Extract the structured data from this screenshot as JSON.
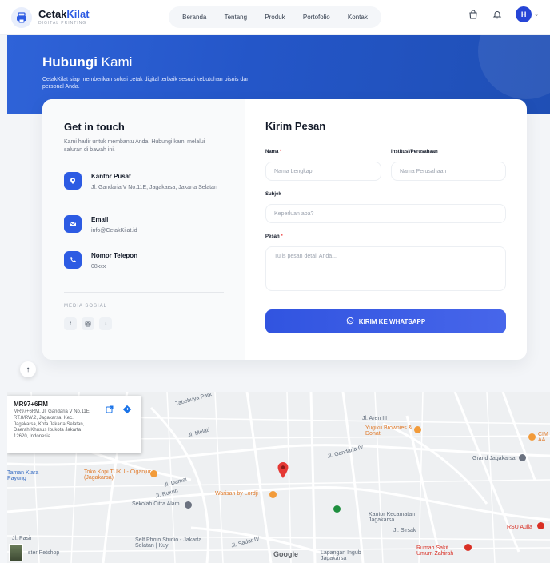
{
  "brand": {
    "name_part1": "Cetak",
    "name_part2": "Kilat",
    "tagline": "DIGITAL PRINTING"
  },
  "nav": {
    "items": [
      "Beranda",
      "Tentang",
      "Produk",
      "Portofolio",
      "Kontak"
    ]
  },
  "user": {
    "initial": "H"
  },
  "hero": {
    "title_bold": "Hubungi",
    "title_rest": " Kami",
    "subtitle": "CetakKilat siap memberikan solusi cetak digital terbaik sesuai kebutuhan bisnis dan personal Anda."
  },
  "contact": {
    "heading": "Get in touch",
    "intro": "Kami hadir untuk membantu Anda. Hubungi kami melalui saluran di bawah ini.",
    "items": [
      {
        "title": "Kantor Pusat",
        "detail": "Jl. Gandaria V No.11E, Jagakarsa, Jakarta Selatan"
      },
      {
        "title": "Email",
        "detail": "info@CetakKilat.id"
      },
      {
        "title": "Nomor Telepon",
        "detail": "08xxx"
      }
    ],
    "social_label": "MEDIA SOSIAL"
  },
  "form": {
    "heading": "Kirim Pesan",
    "name_label": "Nama",
    "name_placeholder": "Nama Lengkap",
    "company_label": "Institusi/Perusahaan",
    "company_placeholder": "Nama Perusahaan",
    "subject_label": "Subjek",
    "subject_placeholder": "Keperluan apa?",
    "message_label": "Pesan",
    "message_placeholder": "Tulis pesan detail Anda...",
    "required_mark": "*",
    "submit_label": "KIRIM KE WHATSAPP"
  },
  "map": {
    "card_title": "MR97+6RM",
    "card_address": "MR97+6RM, Jl. Gandaria V No.11E, RT.8/RW.2, Jagakarsa, Kec. Jagakarsa, Kota Jakarta Selatan, Daerah Khusus Ibukota Jakarta 12620, Indonesia",
    "labels": {
      "tabebuya": "Tabebuya Park",
      "aren": "Jl. Aren III",
      "yugiku": "Yugiku Brownies & Donat",
      "taman": "Taman Kiara Payung",
      "toko": "Toko Kopi TUKU - Ciganjur (Jagakarsa)",
      "warisan": "Warisan by Lordji",
      "sekolah": "Sekolah Citra Alam",
      "kantor": "Kantor Kecamatan Jagakarsa",
      "grand": "Grand Jagakarsa",
      "rsu": "RSU Aulia",
      "self": "Self Photo Studio - Jakarta Selatan | Kuy",
      "rumah": "Rumah Sakit Umum Zahirah",
      "lapangan": "Lapangan Ingub Jagakarsa",
      "pet": "ster Petshop",
      "melati": "Jl. Melati",
      "gandaria": "Jl. Gandaria IV",
      "sirsak": "Jl. Sirsak",
      "damai": "Jl. Damai",
      "pasir": "Jl. Pasir",
      "cim": "CIM AA",
      "rukun": "Jl. Rukun",
      "sadar": "Jl. Sadar IV",
      "google": "Google"
    }
  },
  "colors": {
    "primary": "#2d5be3",
    "hero": "#2456c8",
    "whatsapp_btn": "#3a5be5"
  }
}
